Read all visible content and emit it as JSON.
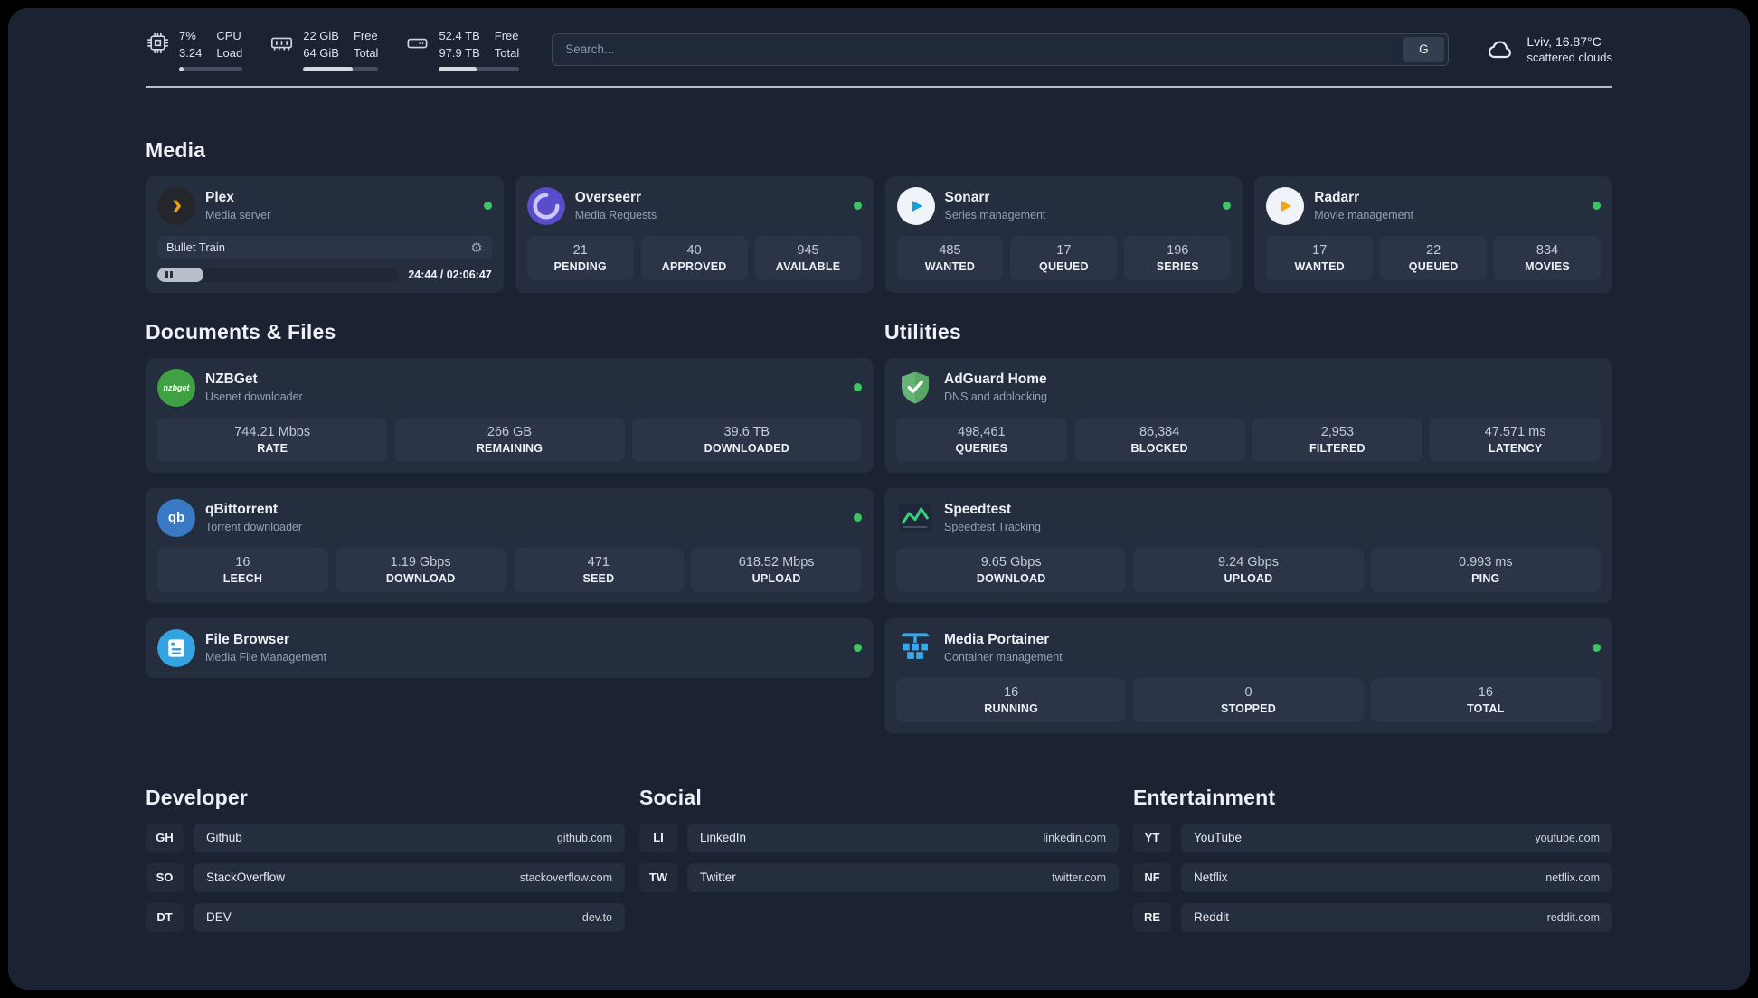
{
  "colors": {
    "background": "#1b2333",
    "card": "#252e3f",
    "tile": "#2c3547",
    "status_online_green": "#3ec463",
    "plex_amber": "#e5a00d",
    "overseerr_purple": "#5a4dcb",
    "sonarr_blue": "#14a0d8",
    "radarr_orange": "#f5a613",
    "nzbget_green": "#40a044",
    "qbittorrent_blue": "#3a79c3",
    "filebrowser_blue": "#35a3e0",
    "adguard_green": "#66b574",
    "speedtest_green": "#35d07f",
    "portainer_blue": "#3aa7e9"
  },
  "icons": {
    "gear": "⚙"
  },
  "topbar": {
    "cpu": {
      "usage": "7%",
      "load": "3.24",
      "label_top": "CPU",
      "label_bottom": "Load",
      "bar_percent": 7
    },
    "memory": {
      "free": "22 GiB",
      "total": "64 GiB",
      "label_top": "Free",
      "label_bottom": "Total",
      "bar_percent": 66
    },
    "storage": {
      "free": "52.4 TB",
      "total": "97.9 TB",
      "label_top": "Free",
      "label_bottom": "Total",
      "bar_percent": 47
    },
    "search": {
      "placeholder": "Search...",
      "engine_button": "G"
    },
    "weather": {
      "location": "Lviv, 16.87°C",
      "condition": "scattered clouds"
    }
  },
  "sections": {
    "media": {
      "title": "Media",
      "plex": {
        "name": "Plex",
        "subtitle": "Media server",
        "now_playing": "Bullet Train",
        "time": "24:44 / 02:06:47",
        "progress_percent": 19
      },
      "overseerr": {
        "name": "Overseerr",
        "subtitle": "Media Requests",
        "stats": [
          {
            "value": "21",
            "label": "PENDING"
          },
          {
            "value": "40",
            "label": "APPROVED"
          },
          {
            "value": "945",
            "label": "AVAILABLE"
          }
        ]
      },
      "sonarr": {
        "name": "Sonarr",
        "subtitle": "Series management",
        "stats": [
          {
            "value": "485",
            "label": "WANTED"
          },
          {
            "value": "17",
            "label": "QUEUED"
          },
          {
            "value": "196",
            "label": "SERIES"
          }
        ]
      },
      "radarr": {
        "name": "Radarr",
        "subtitle": "Movie management",
        "stats": [
          {
            "value": "17",
            "label": "WANTED"
          },
          {
            "value": "22",
            "label": "QUEUED"
          },
          {
            "value": "834",
            "label": "MOVIES"
          }
        ]
      }
    },
    "documents": {
      "title": "Documents & Files",
      "nzbget": {
        "name": "NZBGet",
        "subtitle": "Usenet downloader",
        "icon_text": "nzbget",
        "stats": [
          {
            "value": "744.21 Mbps",
            "label": "RATE"
          },
          {
            "value": "266 GB",
            "label": "REMAINING"
          },
          {
            "value": "39.6 TB",
            "label": "DOWNLOADED"
          }
        ]
      },
      "qbittorrent": {
        "name": "qBittorrent",
        "subtitle": "Torrent downloader",
        "icon_text": "qb",
        "stats": [
          {
            "value": "16",
            "label": "LEECH"
          },
          {
            "value": "1.19 Gbps",
            "label": "DOWNLOAD"
          },
          {
            "value": "471",
            "label": "SEED"
          },
          {
            "value": "618.52 Mbps",
            "label": "UPLOAD"
          }
        ]
      },
      "filebrowser": {
        "name": "File Browser",
        "subtitle": "Media File Management"
      }
    },
    "utilities": {
      "title": "Utilities",
      "adguard": {
        "name": "AdGuard Home",
        "subtitle": "DNS and adblocking",
        "stats": [
          {
            "value": "498,461",
            "label": "QUERIES"
          },
          {
            "value": "86,384",
            "label": "BLOCKED"
          },
          {
            "value": "2,953",
            "label": "FILTERED"
          },
          {
            "value": "47.571 ms",
            "label": "LATENCY"
          }
        ]
      },
      "speedtest": {
        "name": "Speedtest",
        "subtitle": "Speedtest Tracking",
        "stats": [
          {
            "value": "9.65 Gbps",
            "label": "DOWNLOAD"
          },
          {
            "value": "9.24 Gbps",
            "label": "UPLOAD"
          },
          {
            "value": "0.993 ms",
            "label": "PING"
          }
        ]
      },
      "portainer": {
        "name": "Media Portainer",
        "subtitle": "Container management",
        "stats": [
          {
            "value": "16",
            "label": "RUNNING"
          },
          {
            "value": "0",
            "label": "STOPPED"
          },
          {
            "value": "16",
            "label": "TOTAL"
          }
        ]
      }
    },
    "bookmarks": [
      {
        "title": "Developer",
        "items": [
          {
            "abbr": "GH",
            "name": "Github",
            "url": "github.com"
          },
          {
            "abbr": "SO",
            "name": "StackOverflow",
            "url": "stackoverflow.com"
          },
          {
            "abbr": "DT",
            "name": "DEV",
            "url": "dev.to"
          }
        ]
      },
      {
        "title": "Social",
        "items": [
          {
            "abbr": "LI",
            "name": "LinkedIn",
            "url": "linkedin.com"
          },
          {
            "abbr": "TW",
            "name": "Twitter",
            "url": "twitter.com"
          }
        ]
      },
      {
        "title": "Entertainment",
        "items": [
          {
            "abbr": "YT",
            "name": "YouTube",
            "url": "youtube.com"
          },
          {
            "abbr": "NF",
            "name": "Netflix",
            "url": "netflix.com"
          },
          {
            "abbr": "RE",
            "name": "Reddit",
            "url": "reddit.com"
          }
        ]
      }
    ]
  }
}
